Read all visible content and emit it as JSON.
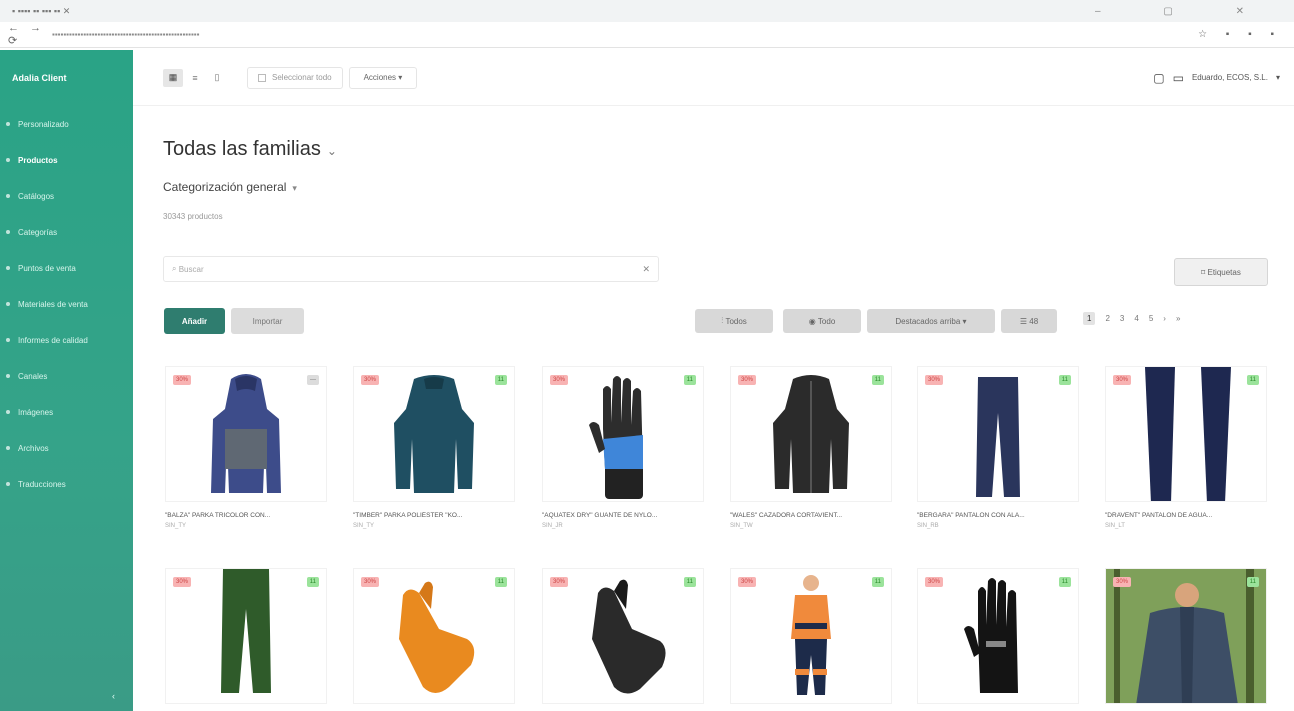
{
  "header": {
    "view_modes": [
      "▦",
      "≡",
      "▯"
    ],
    "select_all": "Seleccionar todo",
    "actions": "Acciones",
    "company": "Eduardo, ECOS, S.L."
  },
  "sidebar": {
    "brand": "Adalia Client",
    "items": [
      {
        "label": "Personalizado"
      },
      {
        "label": "Productos"
      },
      {
        "label": "Catálogos"
      },
      {
        "label": "Categorías"
      },
      {
        "label": "Puntos de venta"
      },
      {
        "label": "Materiales de venta"
      },
      {
        "label": "Informes de calidad"
      },
      {
        "label": "Canales"
      },
      {
        "label": "Imágenes"
      },
      {
        "label": "Archivos"
      },
      {
        "label": "Traducciones"
      }
    ],
    "collapse_icon": "‹"
  },
  "page": {
    "title": "Todas las familias",
    "subtitle": "Categorización general",
    "count": "30343 productos",
    "search_placeholder": "Buscar",
    "export_label": "Etiquetas",
    "add_label": "Añadir",
    "import_label": "Importar",
    "filter_label": "Todos",
    "visibility_label": "Todo",
    "sort_label": "Destacados arriba",
    "per_page_label": "48"
  },
  "pager": [
    "1",
    "2",
    "3",
    "4",
    "5",
    "›",
    "»"
  ],
  "products": [
    {
      "name": "\"BALZA\" PARKA TRICOLOR CON...",
      "sku": "SIN_TY",
      "discount": "30%",
      "tag": "—"
    },
    {
      "name": "\"TIMBER\" PARKA POLIÉSTER \"KO...",
      "sku": "SIN_TY",
      "discount": "30%",
      "tag": "11"
    },
    {
      "name": "\"AQUATEX DRY\" GUANTE DE NYLO...",
      "sku": "SIN_JR",
      "discount": "30%",
      "tag": "11"
    },
    {
      "name": "\"WALES\" CAZADORA CORTAVIENT...",
      "sku": "SIN_TW",
      "discount": "30%",
      "tag": "11"
    },
    {
      "name": "\"BERGARA\" PANTALÓN CON ALA...",
      "sku": "SIN_RB",
      "discount": "30%",
      "tag": "11"
    },
    {
      "name": "\"DRAVENT\" PANTALÓN DE AGUA...",
      "sku": "SIN_LT",
      "discount": "30%",
      "tag": "11"
    },
    {
      "name": "",
      "sku": "",
      "discount": "30%",
      "tag": "11"
    },
    {
      "name": "",
      "sku": "",
      "discount": "30%",
      "tag": "11"
    },
    {
      "name": "",
      "sku": "",
      "discount": "30%",
      "tag": "11"
    },
    {
      "name": "",
      "sku": "",
      "discount": "30%",
      "tag": "11"
    },
    {
      "name": "",
      "sku": "",
      "discount": "30%",
      "tag": "11"
    },
    {
      "name": "",
      "sku": "",
      "discount": "30%",
      "tag": "11"
    }
  ]
}
